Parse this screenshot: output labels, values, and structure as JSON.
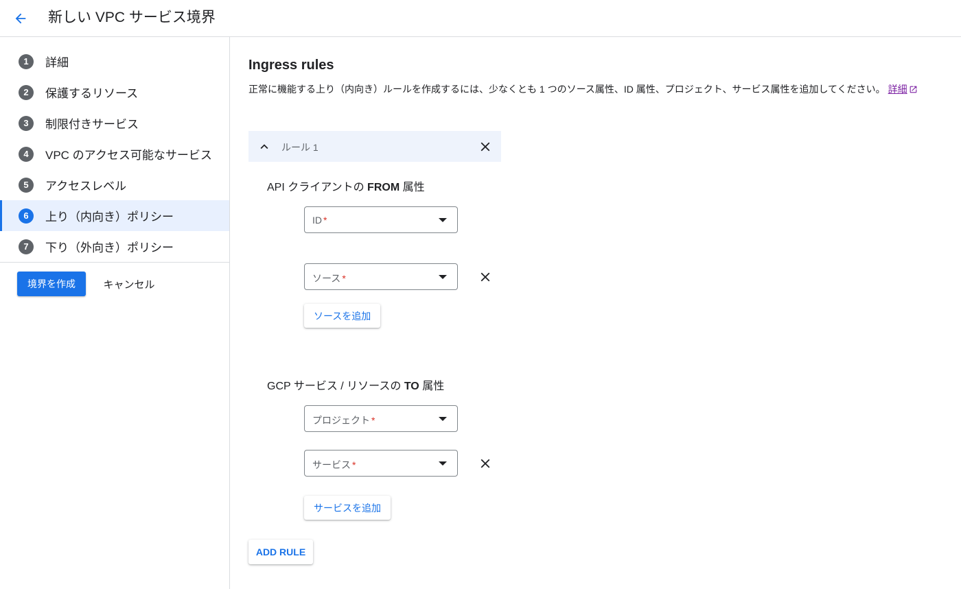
{
  "header": {
    "title": "新しい VPC サービス境界",
    "back_icon": "arrow-back-icon"
  },
  "sidebar": {
    "steps": [
      {
        "num": "1",
        "label": "詳細"
      },
      {
        "num": "2",
        "label": "保護するリソース"
      },
      {
        "num": "3",
        "label": "制限付きサービス"
      },
      {
        "num": "4",
        "label": "VPC のアクセス可能なサービス"
      },
      {
        "num": "5",
        "label": "アクセスレベル"
      },
      {
        "num": "6",
        "label": "上り（内向き）ポリシー",
        "active": true
      },
      {
        "num": "7",
        "label": "下り（外向き）ポリシー"
      }
    ],
    "create_label": "境界を作成",
    "cancel_label": "キャンセル"
  },
  "main": {
    "title": "Ingress rules",
    "description": "正常に機能する上り（内向き）ルールを作成するには、少なくとも 1 つのソース属性、ID 属性、プロジェクト、サービス属性を追加してください。",
    "learn_more": "詳細",
    "rule": {
      "name": "ルール 1",
      "from": {
        "title_prefix": "API クライアントの ",
        "title_bold": "FROM",
        "title_suffix": " 属性",
        "id_placeholder": "ID",
        "source_placeholder": "ソース",
        "add_source": "ソースを追加"
      },
      "to": {
        "title_prefix": "GCP サービス / リソースの ",
        "title_bold": "TO",
        "title_suffix": " 属性",
        "project_placeholder": "プロジェクト",
        "service_placeholder": "サービス",
        "add_service": "サービスを追加"
      }
    },
    "required_mark": "*",
    "add_rule": "ADD RULE"
  },
  "colors": {
    "accent": "#1a73e8",
    "required": "#d93025",
    "link_visited": "#7b1fa2"
  }
}
